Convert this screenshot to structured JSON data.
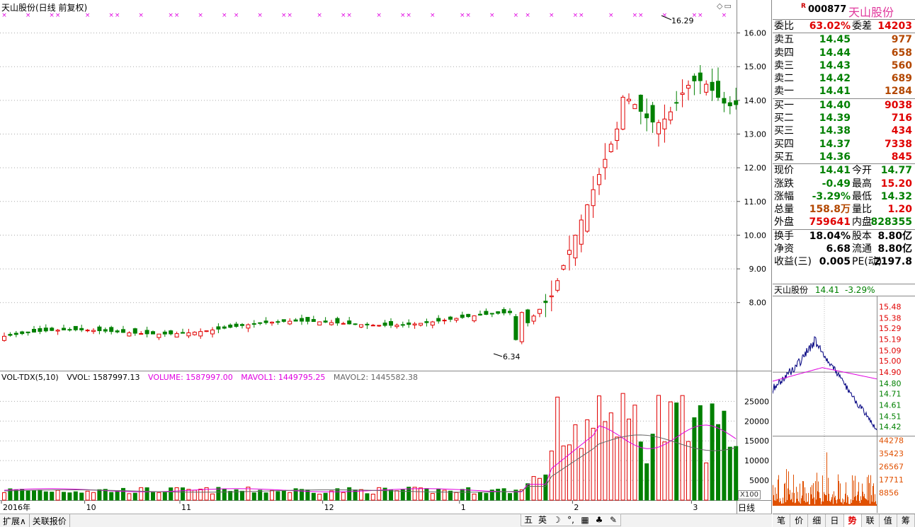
{
  "header": {
    "title": "天山股份(日线 前复权)",
    "corner_icons": "◇▭"
  },
  "price_chart": {
    "ymin": 6.0,
    "ymax": 16.6,
    "axis_ticks": [
      "16.00",
      "15.00",
      "14.00",
      "13.00",
      "12.00",
      "11.00",
      "10.00",
      "9.00",
      "8.00"
    ],
    "axis_values": [
      16,
      15,
      14,
      13,
      12,
      11,
      10,
      9,
      8
    ],
    "high_label": "16.29",
    "low_label": "6.34",
    "x_labels": [
      "2016年",
      "10",
      "11",
      "12",
      "1",
      "2",
      "3"
    ],
    "x_label_idx": [
      0,
      14,
      30,
      54,
      77,
      96,
      116
    ],
    "marker_count": 38,
    "colors": {
      "up": "#e00000",
      "down": "#008000",
      "flat": "#000000",
      "marker": "#e000e0"
    }
  },
  "volume_header": {
    "name": "VOL-TDX(5,10)",
    "vvol": "VVOL: 1587997.13",
    "volume": "VOLUME: 1587997.00",
    "mavol1": "MAVOL1: 1449795.25",
    "mavol2": "MAVOL2: 1445582.38"
  },
  "volume_chart": {
    "ymax": 29000,
    "axis_ticks": [
      "25000",
      "20000",
      "15000",
      "10000",
      "5000"
    ],
    "axis_values": [
      25000,
      20000,
      15000,
      10000,
      5000
    ],
    "unit": "X100"
  },
  "period_label": "日线",
  "bottom_tabs": [
    "扩展∧",
    "关联报价"
  ],
  "ime_bar": [
    "五",
    "英",
    "☽",
    "°,",
    "▦",
    "♣",
    "✎"
  ],
  "stock": {
    "r_badge": "R",
    "code": "000877",
    "name": "天山股份"
  },
  "quote": {
    "wei_bi_label": "委比",
    "wei_bi": "63.02%",
    "wei_cha_label": "委差",
    "wei_cha": "14203",
    "sell": [
      {
        "l": "卖五",
        "p": "14.45",
        "v": "977"
      },
      {
        "l": "卖四",
        "p": "14.44",
        "v": "658"
      },
      {
        "l": "卖三",
        "p": "14.43",
        "v": "560"
      },
      {
        "l": "卖二",
        "p": "14.42",
        "v": "689"
      },
      {
        "l": "卖一",
        "p": "14.41",
        "v": "1284"
      }
    ],
    "buy": [
      {
        "l": "买一",
        "p": "14.40",
        "v": "9038"
      },
      {
        "l": "买二",
        "p": "14.39",
        "v": "716"
      },
      {
        "l": "买三",
        "p": "14.38",
        "v": "434"
      },
      {
        "l": "买四",
        "p": "14.37",
        "v": "7338"
      },
      {
        "l": "买五",
        "p": "14.36",
        "v": "845"
      }
    ],
    "stats": [
      {
        "l": "现价",
        "v": "14.41",
        "l2": "今开",
        "v2": "14.77",
        "c": "grn",
        "c2": "grn"
      },
      {
        "l": "涨跌",
        "v": "-0.49",
        "l2": "最高",
        "v2": "15.20",
        "c": "grn",
        "c2": "red"
      },
      {
        "l": "涨幅",
        "v": "-3.29%",
        "l2": "最低",
        "v2": "14.32",
        "c": "grn",
        "c2": "grn"
      },
      {
        "l": "总量",
        "v": "158.8万",
        "l2": "量比",
        "v2": "1.20",
        "c": "brn",
        "c2": "red"
      },
      {
        "l": "外盘",
        "v": "759641",
        "l2": "内盘",
        "v2": "828355",
        "c": "red",
        "c2": "grn"
      }
    ],
    "funds": [
      {
        "l": "换手",
        "v": "18.04%",
        "l2": "股本",
        "v2": "8.80亿"
      },
      {
        "l": "净资",
        "v": "6.68",
        "l2": "流通",
        "v2": "8.80亿"
      },
      {
        "l": "收益(三)",
        "v": "0.005",
        "l2": "PE(动)",
        "v2": "2197.8"
      }
    ]
  },
  "intraday": {
    "name": "天山股份",
    "price": "14.41",
    "pct": "-3.29%",
    "price_ticks": [
      "15.48",
      "15.38",
      "15.29",
      "15.19",
      "15.09",
      "15.00",
      "14.90",
      "14.80",
      "14.71",
      "14.61",
      "14.51",
      "14.42"
    ],
    "price_tick_values": [
      15.48,
      15.38,
      15.29,
      15.19,
      15.09,
      15.0,
      14.9,
      14.8,
      14.71,
      14.61,
      14.51,
      14.42
    ],
    "pmin": 14.35,
    "pmax": 15.52,
    "vol_ticks": [
      "44278",
      "35423",
      "26567",
      "17711",
      "8856"
    ],
    "vol_tick_values": [
      44278,
      35423,
      26567,
      17711,
      8856
    ]
  },
  "right_tabs": [
    "笔",
    "价",
    "细",
    "日",
    "势",
    "联",
    "值",
    "筹"
  ],
  "right_tab_active": "势"
}
